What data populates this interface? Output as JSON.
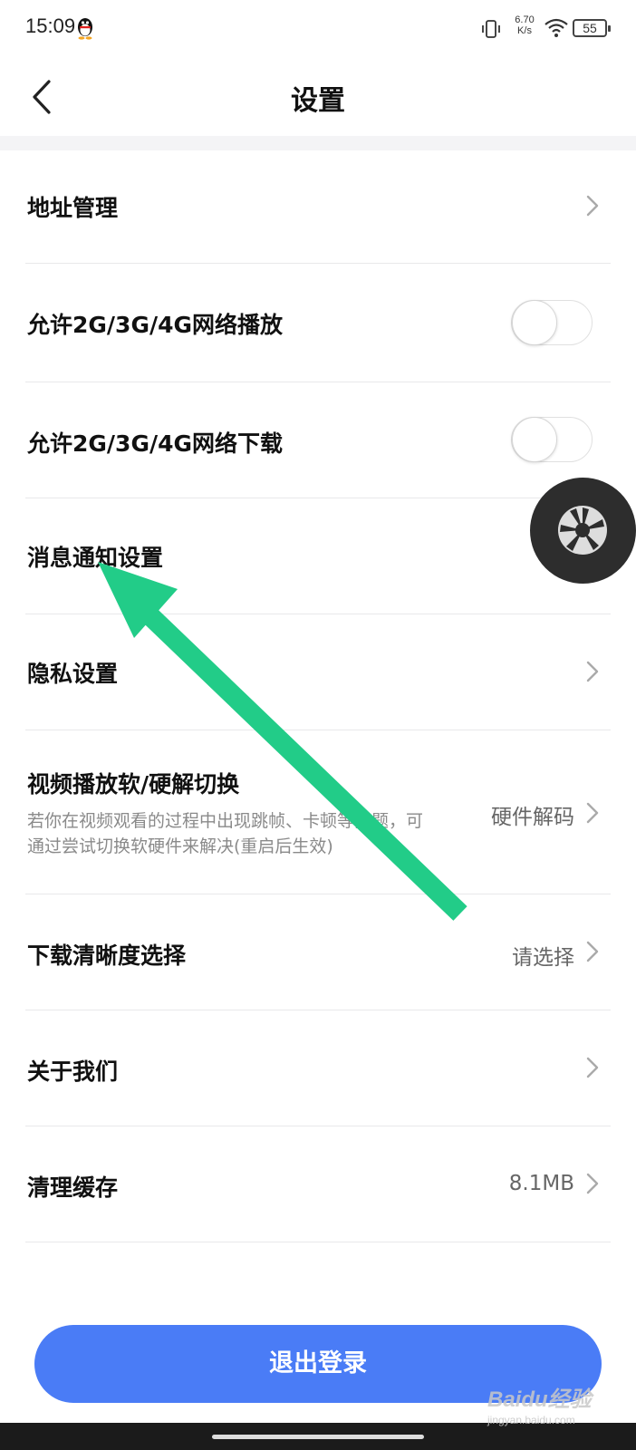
{
  "status_bar": {
    "time": "15:09",
    "net_speed_value": "6.70",
    "net_speed_unit": "K/s",
    "battery": "55",
    "icons": [
      "qq-penguin-icon",
      "vibrate-icon",
      "wifi-icon",
      "battery-icon"
    ]
  },
  "header": {
    "title": "设置",
    "back_icon": "chevron-left-icon"
  },
  "settings": {
    "address": {
      "label": "地址管理"
    },
    "allow_play": {
      "label": "允许2G/3G/4G网络播放",
      "enabled": false
    },
    "allow_download": {
      "label": "允许2G/3G/4G网络下载",
      "enabled": false
    },
    "notification": {
      "label": "消息通知设置"
    },
    "privacy": {
      "label": "隐私设置"
    },
    "decode": {
      "label": "视频播放软/硬解切换",
      "description": "若你在视频观看的过程中出现跳帧、卡顿等问题，可通过尝试切换软硬件来解决(重启后生效)",
      "value": "硬件解码"
    },
    "download_quality": {
      "label": "下载清晰度选择",
      "value": "请选择"
    },
    "about": {
      "label": "关于我们"
    },
    "clear_cache": {
      "label": "清理缓存",
      "value": "8.1MB"
    }
  },
  "logout_button": {
    "label": "退出登录"
  },
  "watermark": {
    "text": "Baidu经验",
    "sub": "jingyan.baidu.com"
  },
  "colors": {
    "primary_button": "#4a7cf6",
    "annotation_arrow": "#22cc88",
    "floating_button": "#2d2d2d"
  }
}
